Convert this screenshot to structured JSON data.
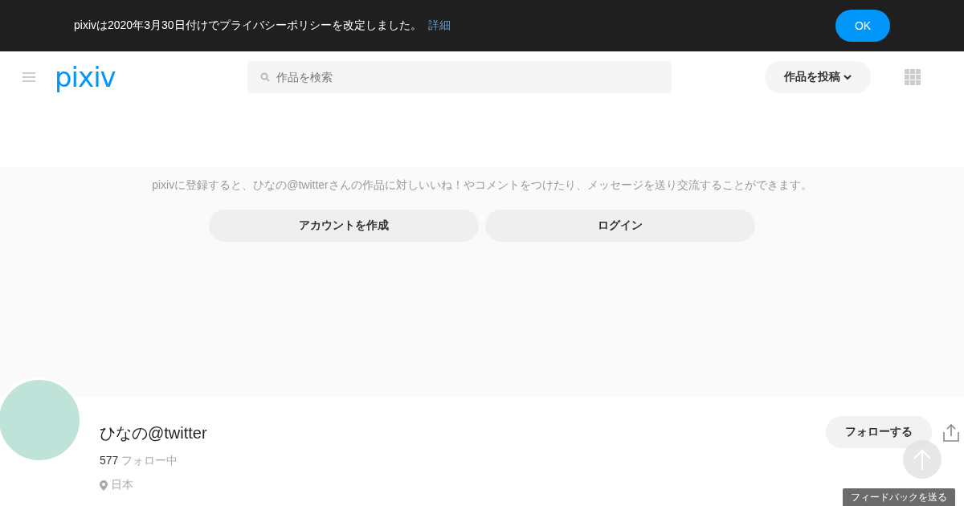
{
  "notice": {
    "text": "pixivは2020年3月30日付けでプライバシーポリシーを改定しました。",
    "link": "詳細",
    "button": "OK"
  },
  "header": {
    "logo": "pixiv",
    "search": {
      "placeholder": "作品を検索"
    },
    "post_button": "作品を投稿"
  },
  "signup": {
    "message": "pixivに登録すると、ひなの@twitterさんの作品に対しいいね！やコメントをつけたり、メッセージを送り交流することができます。",
    "buttons": [
      "アカウントを作成",
      "ログイン"
    ]
  },
  "profile": {
    "name": "ひなの@twitter",
    "following_count": "577",
    "following_label": "フォロー中",
    "location": "日本",
    "follow_button": "フォローする"
  },
  "feedback_button": "フィードバックを送る"
}
